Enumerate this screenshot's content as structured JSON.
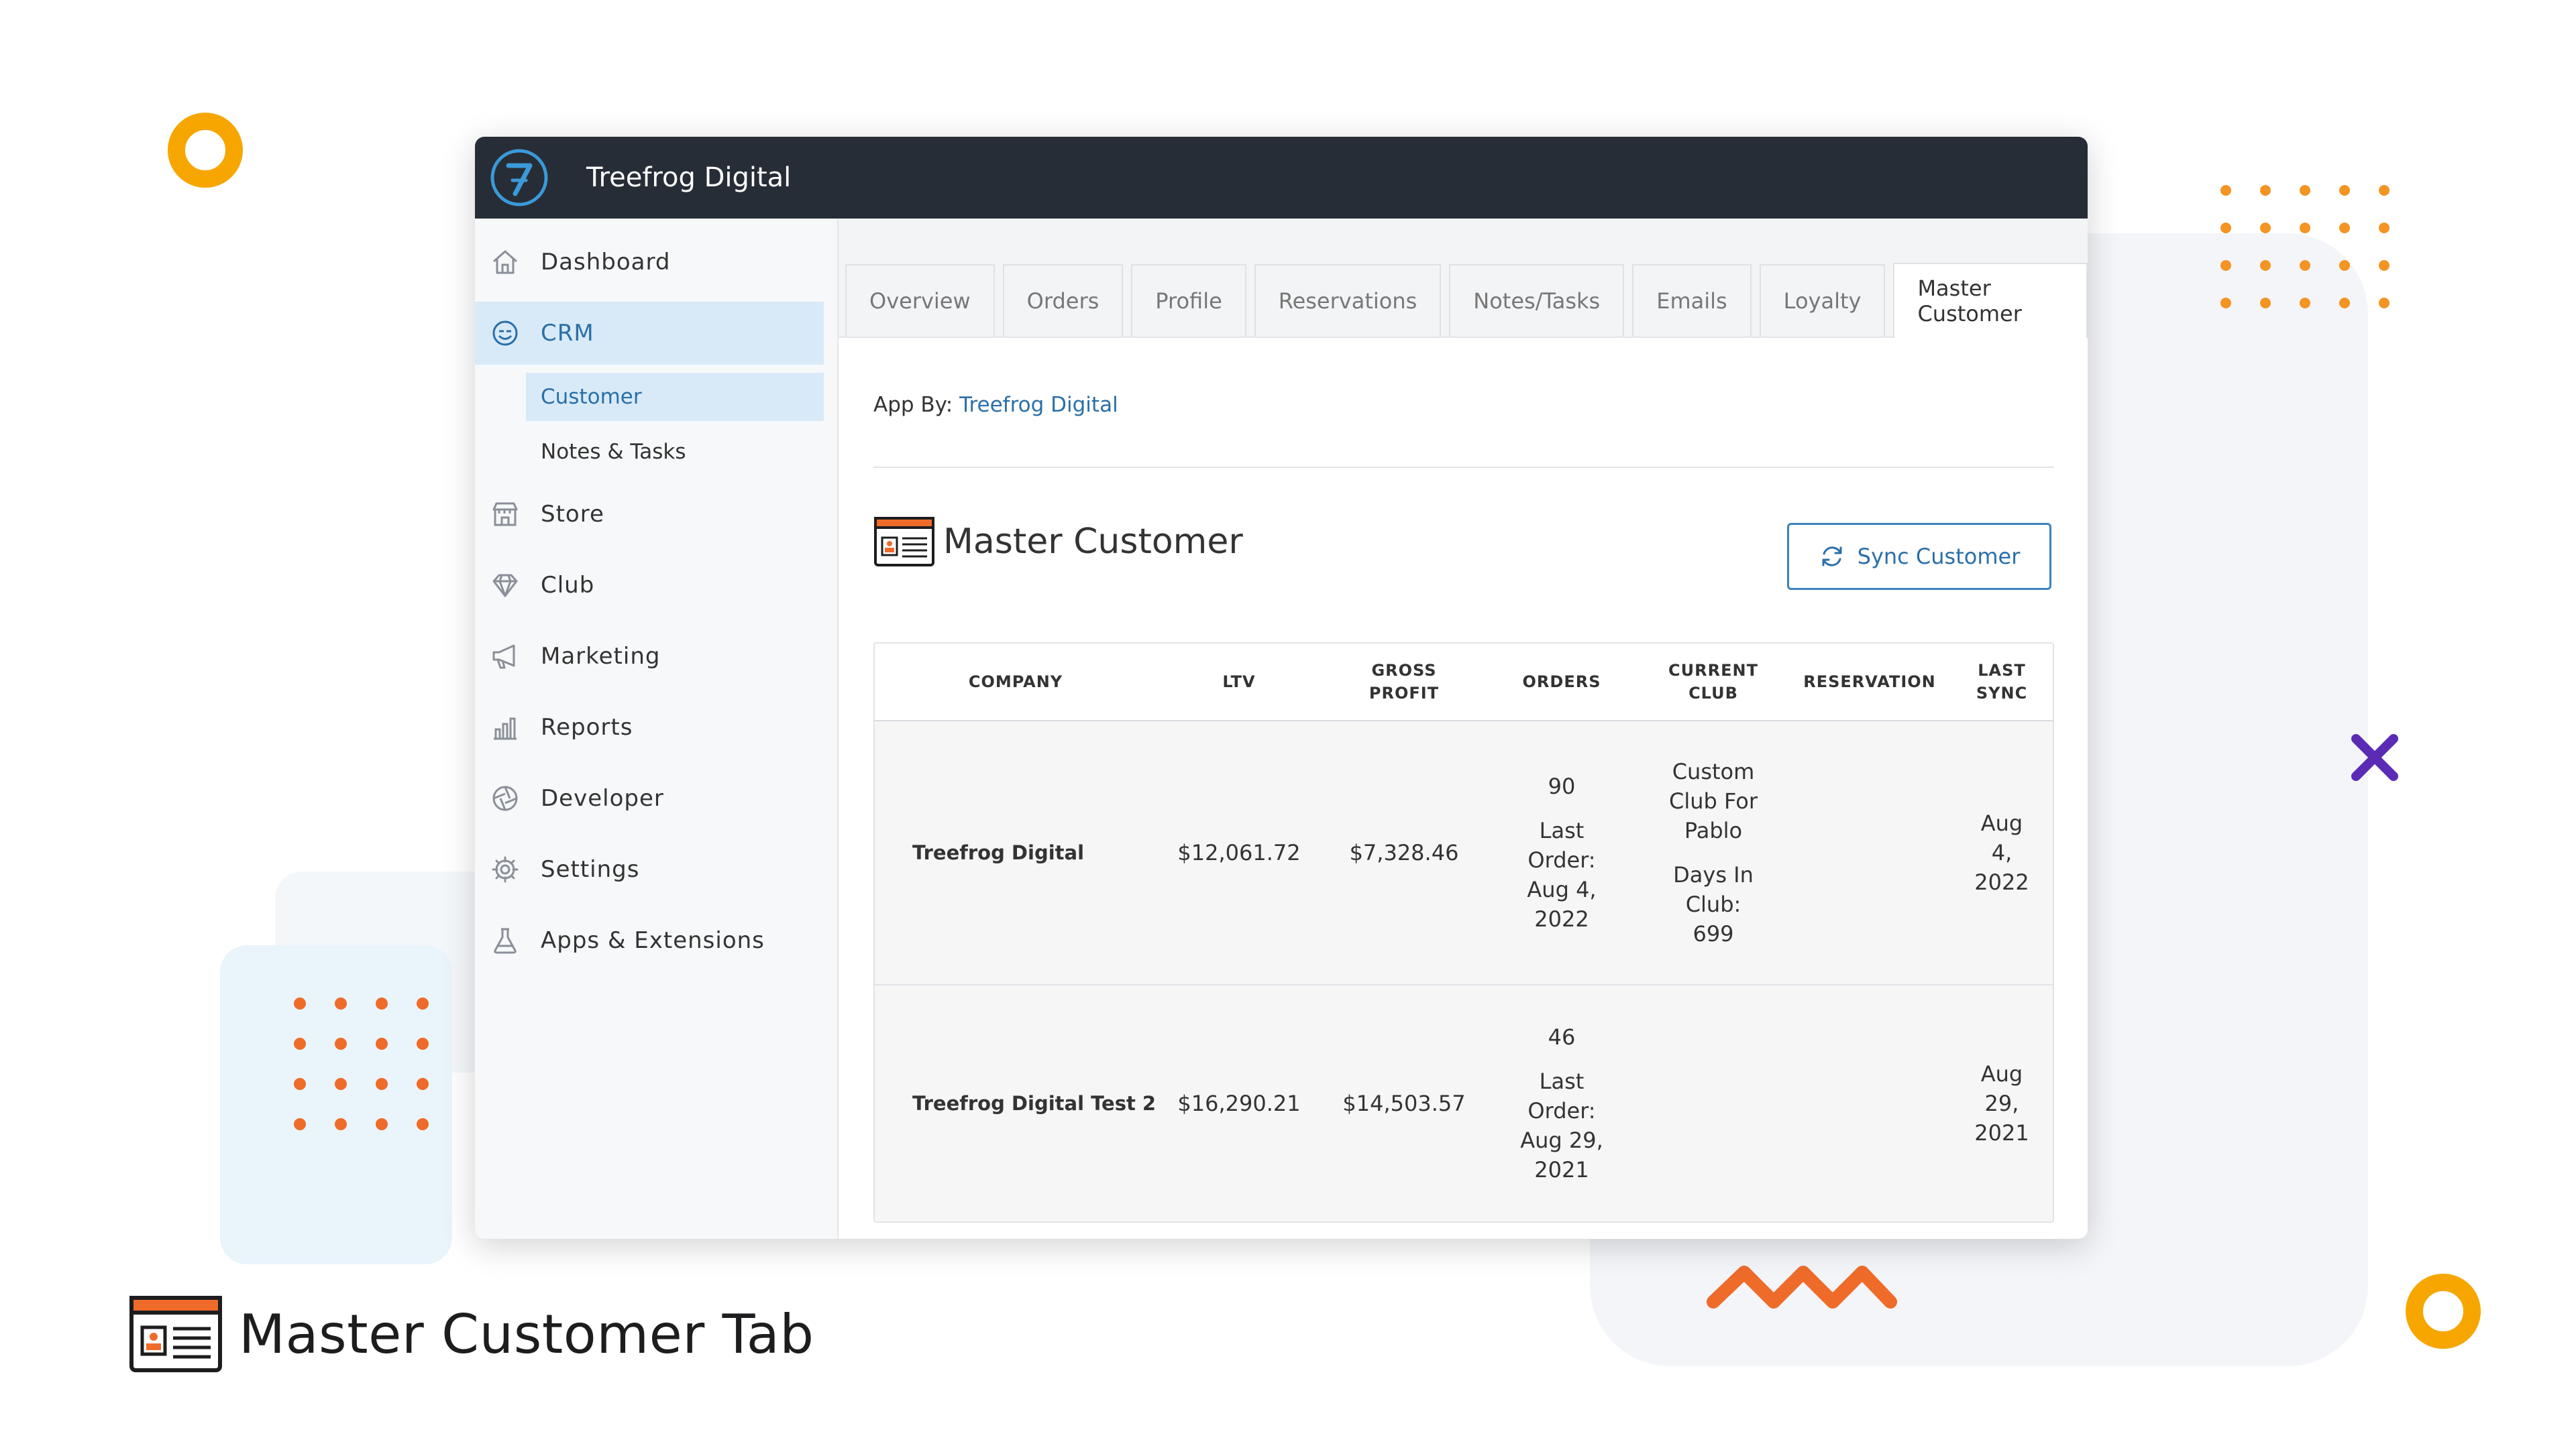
{
  "app": {
    "brand": "Treefrog Digital",
    "logo_glyph": "7"
  },
  "caption": {
    "title": "Master Customer Tab"
  },
  "sidebar": {
    "items": [
      {
        "label": "Dashboard",
        "icon": "home-icon"
      },
      {
        "label": "CRM",
        "icon": "smile-icon",
        "active": true
      },
      {
        "label": "Store",
        "icon": "store-icon"
      },
      {
        "label": "Club",
        "icon": "diamond-icon"
      },
      {
        "label": "Marketing",
        "icon": "megaphone-icon"
      },
      {
        "label": "Reports",
        "icon": "chart-icon"
      },
      {
        "label": "Developer",
        "icon": "aperture-icon"
      },
      {
        "label": "Settings",
        "icon": "gear-icon"
      },
      {
        "label": "Apps & Extensions",
        "icon": "flask-icon"
      }
    ],
    "crm_sub": [
      {
        "label": "Customer",
        "active": true
      },
      {
        "label": "Notes & Tasks"
      }
    ]
  },
  "tabs": [
    {
      "label": "Overview"
    },
    {
      "label": "Orders"
    },
    {
      "label": "Profile"
    },
    {
      "label": "Reservations"
    },
    {
      "label": "Notes/Tasks"
    },
    {
      "label": "Emails"
    },
    {
      "label": "Loyalty"
    },
    {
      "label": "Master Customer",
      "active": true
    }
  ],
  "content": {
    "app_by_label": "App By:",
    "app_by_link": "Treefrog Digital",
    "section_title": "Master Customer",
    "sync_button": "Sync Customer"
  },
  "table": {
    "headers": {
      "company": "COMPANY",
      "ltv": "LTV",
      "gross_1": "GROSS",
      "gross_2": "PROFIT",
      "orders": "ORDERS",
      "club_1": "CURRENT",
      "club_2": "CLUB",
      "reservation": "RESERVATION",
      "sync_1": "LAST",
      "sync_2": "SYNC"
    },
    "rows": [
      {
        "company": "Treefrog Digital",
        "ltv": "$12,061.72",
        "gross_profit": "$7,328.46",
        "orders_count": "90",
        "orders_last": [
          "Last",
          "Order:",
          "Aug 4,",
          "2022"
        ],
        "club_name": [
          "Custom",
          "Club For",
          "Pablo"
        ],
        "club_days": [
          "Days In",
          "Club:",
          "699"
        ],
        "reservation": "",
        "last_sync": [
          "Aug",
          "4,",
          "2022"
        ]
      },
      {
        "company": "Treefrog Digital Test 2",
        "ltv": "$16,290.21",
        "gross_profit": "$14,503.57",
        "orders_count": "46",
        "orders_last": [
          "Last",
          "Order:",
          "Aug 29,",
          "2021"
        ],
        "club_name": [],
        "club_days": [],
        "reservation": "",
        "last_sync": [
          "Aug",
          "29,",
          "2021"
        ]
      }
    ]
  },
  "colors": {
    "topbar": "#272d36",
    "accent": "#2a6fa8",
    "active_bg": "#d8eaf8",
    "ring": "#f7a600",
    "dots": "#f39423",
    "x_mark": "#5b2bb5",
    "zigzag": "#ef6b2a"
  }
}
